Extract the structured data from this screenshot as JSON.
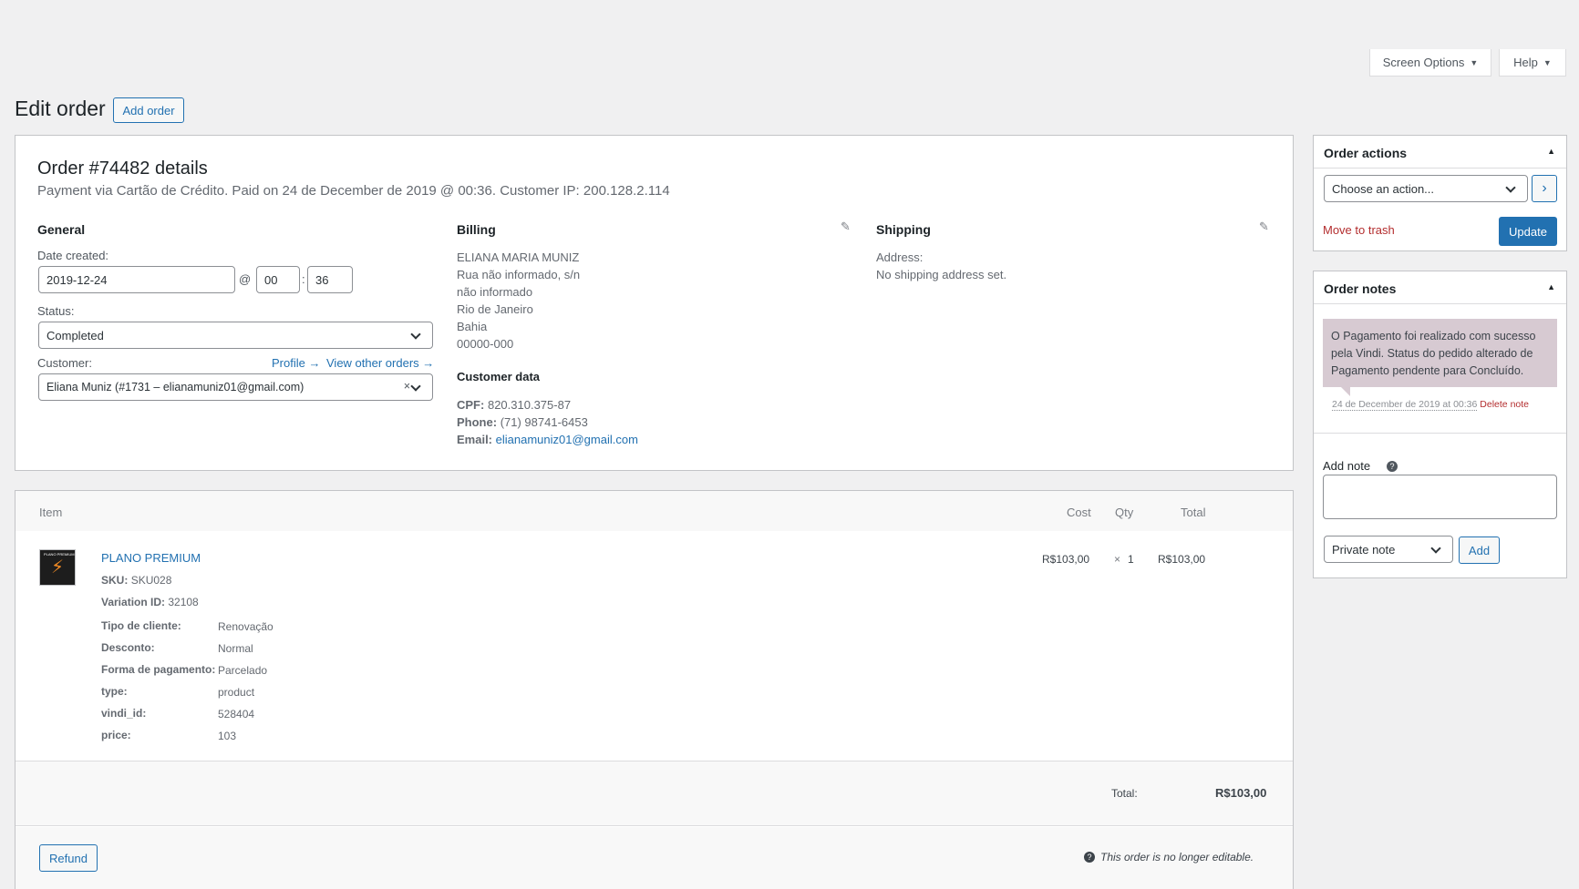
{
  "screen_options": {
    "label": "Screen Options",
    "help": "Help"
  },
  "header": {
    "title": "Edit order",
    "add_button": "Add order"
  },
  "order": {
    "title": "Order #74482 details",
    "subtitle": "Payment via Cartão de Crédito. Paid on 24 de December de 2019 @ 00:36. Customer IP: 200.128.2.114"
  },
  "general": {
    "heading": "General",
    "date_label": "Date created:",
    "date_value": "2019-12-24",
    "at": "@",
    "hour": "00",
    "colon": ":",
    "minute": "36",
    "status_label": "Status:",
    "status_value": "Completed",
    "customer_label": "Customer:",
    "profile_link": "Profile →",
    "other_orders_link": "View other orders →",
    "customer_value": "Eliana Muniz (#1731 – elianamuniz01@gmail.com)",
    "clear": "×"
  },
  "billing": {
    "heading": "Billing",
    "lines": [
      "ELIANA MARIA MUNIZ",
      "Rua não informado, s/n",
      "não informado",
      "Rio de Janeiro",
      "Bahia",
      "00000-000"
    ],
    "customer_data_heading": "Customer data",
    "cpf_label": "CPF:",
    "cpf": "820.310.375-87",
    "phone_label": "Phone:",
    "phone": "(71) 98741-6453",
    "email_label": "Email:",
    "email": "elianamuniz01@gmail.com"
  },
  "shipping": {
    "heading": "Shipping",
    "address_label": "Address:",
    "address_value": "No shipping address set."
  },
  "items": {
    "columns": {
      "item": "Item",
      "cost": "Cost",
      "qty": "Qty",
      "total": "Total"
    },
    "product": {
      "thumb_text": "PLANO PREMIUM",
      "name": "PLANO PREMIUM",
      "sku_label": "SKU:",
      "sku": "SKU028",
      "variation_label": "Variation ID:",
      "variation": "32108",
      "meta": [
        {
          "key": "Tipo de cliente:",
          "value": "Renovação"
        },
        {
          "key": "Desconto:",
          "value": "Normal"
        },
        {
          "key": "Forma de pagamento:",
          "value": "Parcelado"
        },
        {
          "key": "type:",
          "value": "product"
        },
        {
          "key": "vindi_id:",
          "value": "528404"
        },
        {
          "key": "price:",
          "value": "103"
        }
      ],
      "cost": "R$103,00",
      "qty_x": "×",
      "qty": "1",
      "total": "R$103,00"
    },
    "total_label": "Total:",
    "total_value": "R$103,00",
    "refund_button": "Refund",
    "not_editable": "This order is no longer editable."
  },
  "order_actions": {
    "title": "Order actions",
    "select_placeholder": "Choose an action...",
    "go": "›",
    "trash": "Move to trash",
    "update": "Update"
  },
  "order_notes": {
    "title": "Order notes",
    "note_text": "O Pagamento foi realizado com sucesso pela Vindi. Status do pedido alterado de Pagamento pendente para Concluído.",
    "note_meta": "24 de December de 2019 at 00:36",
    "delete_note": "Delete note",
    "add_note_label": "Add note",
    "help": "?",
    "note_type": "Private note",
    "add_button": "Add"
  },
  "colors": {
    "accent": "#2271b1",
    "note_bg": "#d7cad2",
    "danger": "#b32d2e"
  }
}
